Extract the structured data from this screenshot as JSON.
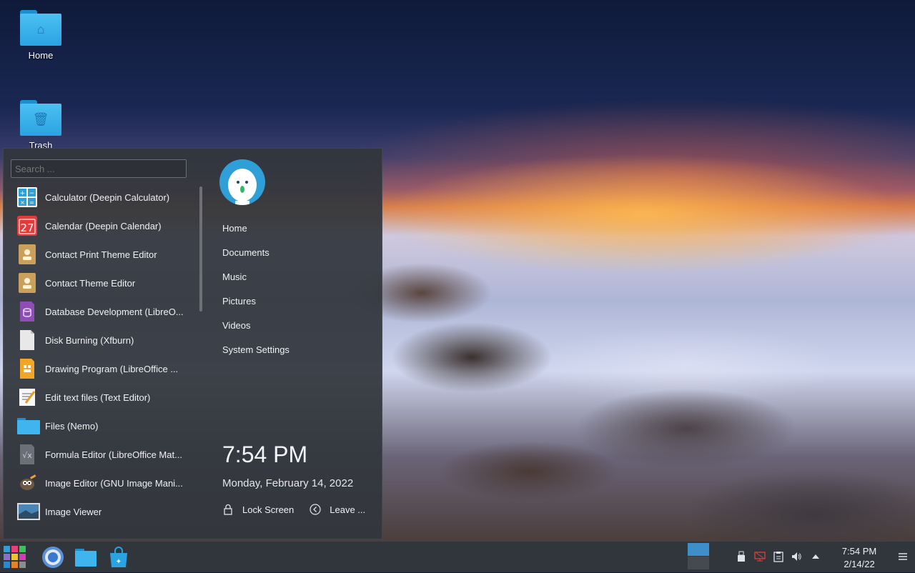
{
  "desktop": {
    "icons": [
      {
        "label": "Home"
      },
      {
        "label": "Trash"
      }
    ]
  },
  "launcher": {
    "search_placeholder": "Search ...",
    "apps": [
      {
        "label": "Calculator (Deepin Calculator)",
        "icon": "calculator-icon"
      },
      {
        "label": "Calendar (Deepin Calendar)",
        "icon": "calendar-icon",
        "badge": "27"
      },
      {
        "label": "Contact Print Theme Editor",
        "icon": "contact-print-theme-icon"
      },
      {
        "label": "Contact Theme Editor",
        "icon": "contact-theme-icon"
      },
      {
        "label": "Database Development (LibreO...",
        "icon": "libreoffice-base-icon"
      },
      {
        "label": "Disk Burning (Xfburn)",
        "icon": "disk-burning-icon"
      },
      {
        "label": "Drawing Program (LibreOffice ...",
        "icon": "libreoffice-draw-icon"
      },
      {
        "label": "Edit text files (Text Editor)",
        "icon": "text-editor-icon"
      },
      {
        "label": "Files (Nemo)",
        "icon": "folder-icon"
      },
      {
        "label": "Formula Editor (LibreOffice Mat...",
        "icon": "libreoffice-math-icon"
      },
      {
        "label": "Image Editor (GNU Image Mani...",
        "icon": "gimp-icon"
      },
      {
        "label": "Image Viewer",
        "icon": "image-viewer-icon"
      }
    ],
    "places": [
      "Home",
      "Documents",
      "Music",
      "Pictures",
      "Videos",
      "System Settings"
    ],
    "time": "7:54 PM",
    "date": "Monday, February 14, 2022",
    "lock_label": "Lock Screen",
    "leave_label": "Leave ..."
  },
  "taskbar": {
    "clock_time": "7:54 PM",
    "clock_date": "2/14/22",
    "items": [
      "start-menu-icon",
      "chromium-icon",
      "file-manager-icon",
      "software-store-icon"
    ],
    "tray": [
      "usb-icon",
      "network-icon",
      "clipboard-icon",
      "volume-icon",
      "expand-tray-icon",
      "menu-icon"
    ]
  },
  "colors": {
    "panel": "#31363c",
    "launcher_bg": "#32363c",
    "accent": "#2f9fd8"
  }
}
